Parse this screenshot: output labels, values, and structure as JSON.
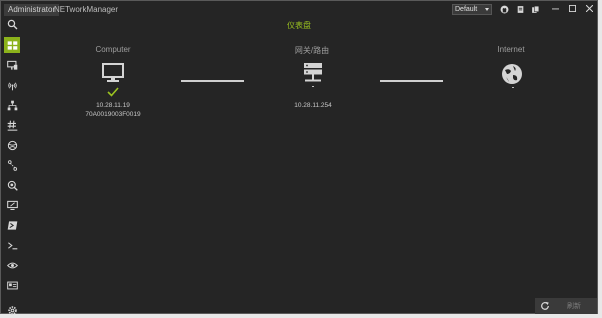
{
  "titlebar": {
    "user_badge": "Administrator",
    "app_name": "NETworkManager",
    "profile_selected": "Default"
  },
  "page": {
    "title": "仪表盘"
  },
  "dashboard": {
    "computer": {
      "label": "Computer",
      "ip": "10.28.11.19",
      "mac": "70A0019003F0019",
      "status": "connected"
    },
    "gateway": {
      "label": "网关/路由",
      "ip": "10.28.11.254",
      "status": "dash"
    },
    "internet": {
      "label": "Internet",
      "status": "dash"
    }
  },
  "footer": {
    "refresh_label": "刷新"
  },
  "sidebar": {
    "items": [
      {
        "name": "search-icon",
        "active": false
      },
      {
        "name": "dashboard-icon",
        "active": true
      },
      {
        "name": "network-interface-icon",
        "active": false
      },
      {
        "name": "wifi-icon",
        "active": false
      },
      {
        "name": "ip-scanner-icon",
        "active": false
      },
      {
        "name": "port-scanner-icon",
        "active": false
      },
      {
        "name": "ping-monitor-icon",
        "active": false
      },
      {
        "name": "traceroute-icon",
        "active": false
      },
      {
        "name": "dns-lookup-icon",
        "active": false
      },
      {
        "name": "remote-desktop-icon",
        "active": false
      },
      {
        "name": "powershell-icon",
        "active": false
      },
      {
        "name": "terminal-icon",
        "active": false
      },
      {
        "name": "eye-icon",
        "active": false
      },
      {
        "name": "card-icon",
        "active": false
      },
      {
        "name": "settings-icon",
        "active": false
      }
    ]
  },
  "colors": {
    "accent": "#8bb21b",
    "background": "#252525"
  }
}
